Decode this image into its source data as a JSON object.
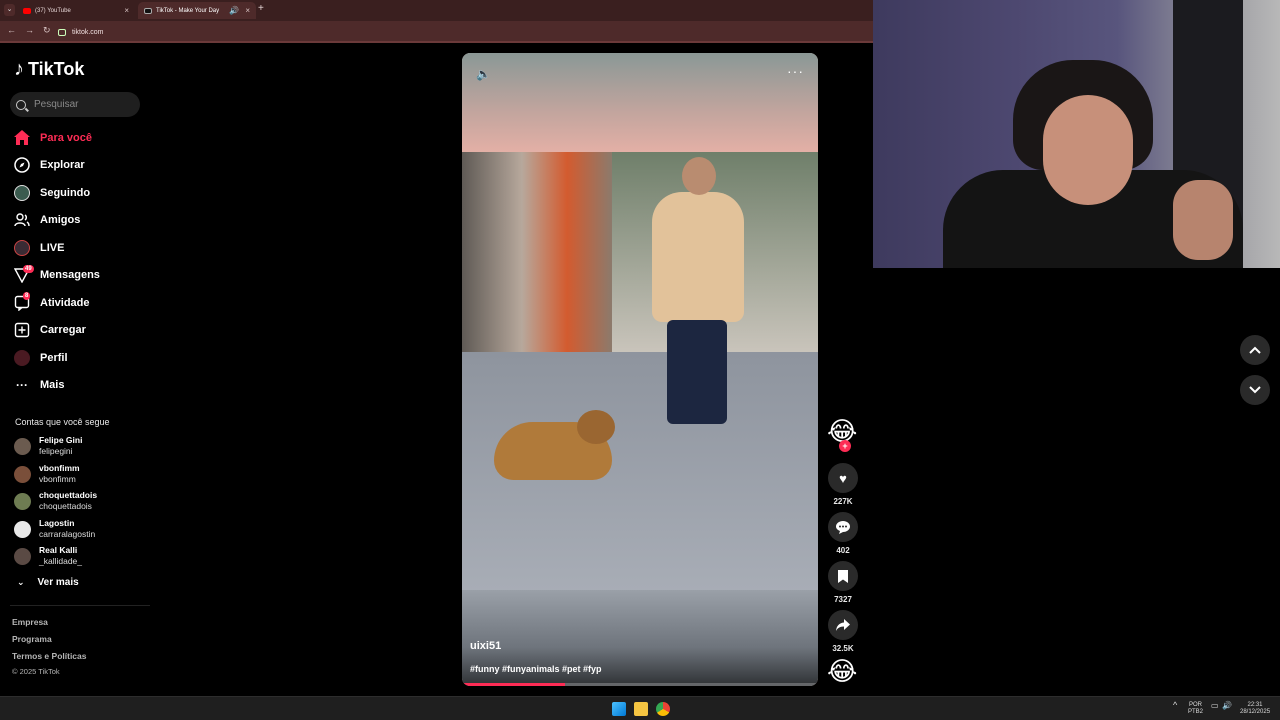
{
  "browser": {
    "tabs": [
      {
        "label": "(37) YouTube",
        "close": "×"
      },
      {
        "label": "TikTok - Make Your Day",
        "close": "×",
        "audio": "🔊"
      }
    ],
    "new_tab": "+",
    "tab_menu": "⌄",
    "back": "←",
    "forward": "→",
    "reload": "↻",
    "url": "tiktok.com"
  },
  "sidebar": {
    "logo": "TikTok",
    "search_placeholder": "Pesquisar",
    "nav": [
      {
        "label": "Para você",
        "icon": "home-icon",
        "active": true
      },
      {
        "label": "Explorar",
        "icon": "compass-icon"
      },
      {
        "label": "Seguindo",
        "icon": "following-avatar-icon"
      },
      {
        "label": "Amigos",
        "icon": "friends-icon"
      },
      {
        "label": "LIVE",
        "icon": "live-icon"
      },
      {
        "label": "Mensagens",
        "icon": "messages-icon",
        "badge": "49"
      },
      {
        "label": "Atividade",
        "icon": "activity-icon",
        "badge": "8"
      },
      {
        "label": "Carregar",
        "icon": "upload-icon"
      },
      {
        "label": "Perfil",
        "icon": "profile-icon"
      },
      {
        "label": "Mais",
        "icon": "more-icon"
      }
    ],
    "following_title": "Contas que você segue",
    "following": [
      {
        "name": "Felipe Gini",
        "handle": "felipegini",
        "color": "#6b5b4f"
      },
      {
        "name": "vbonfimm",
        "handle": "vbonfimm",
        "color": "#7a4f3a"
      },
      {
        "name": "choquettadois",
        "handle": "choquettadois",
        "color": "#6e7c52"
      },
      {
        "name": "Lagostin",
        "handle": "carraralagostin",
        "color": "#e8e8e8"
      },
      {
        "name": "Real Kalli",
        "handle": "_kallidade_",
        "color": "#5a4a44"
      }
    ],
    "see_more": "Ver mais",
    "footer": [
      "Empresa",
      "Programa",
      "Termos e Políticas"
    ],
    "copyright": "© 2025 TikTok"
  },
  "video": {
    "author": "uixi51",
    "caption": "#funny #funyanimals #pet #fyp",
    "progress_percent": 29
  },
  "actions": {
    "likes": "227K",
    "comments": "402",
    "saves": "7327",
    "shares": "32.5K"
  },
  "taskbar": {
    "lang_top": "POR",
    "lang_bottom": "PTB2",
    "time": "22:31",
    "date": "28/12/2025"
  },
  "colors": {
    "accent": "#fe2c55",
    "tab_bar": "#3a1f1f",
    "address_bar": "#4e2a2a"
  }
}
